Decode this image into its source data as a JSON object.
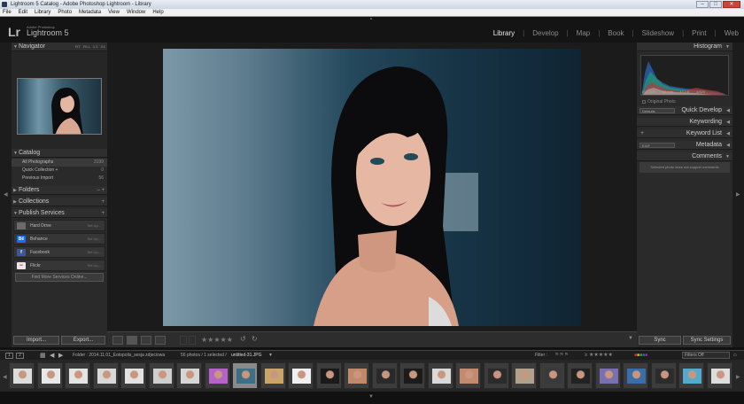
{
  "window": {
    "title": "Lightroom 5 Catalog - Adobe Photoshop Lightroom - Library",
    "controls": [
      "–",
      "□",
      "✕"
    ]
  },
  "menu": [
    "File",
    "Edit",
    "Library",
    "Photo",
    "Metadata",
    "View",
    "Window",
    "Help"
  ],
  "identity": {
    "logo": "Lr",
    "sub": "Adobe Photoshop",
    "name": "Lightroom 5"
  },
  "modules": [
    {
      "label": "Library",
      "active": true
    },
    {
      "label": "Develop",
      "active": false
    },
    {
      "label": "Map",
      "active": false
    },
    {
      "label": "Book",
      "active": false
    },
    {
      "label": "Slideshow",
      "active": false
    },
    {
      "label": "Print",
      "active": false
    },
    {
      "label": "Web",
      "active": false
    }
  ],
  "left": {
    "navigator": {
      "title": "Navigator",
      "zoom": [
        "FIT",
        "FILL",
        "1:1",
        "3:1"
      ]
    },
    "catalog": {
      "title": "Catalog",
      "rows": [
        {
          "label": "All Photographs",
          "count": "3199"
        },
        {
          "label": "Quick Collection +",
          "count": "0"
        },
        {
          "label": "Previous Import",
          "count": "56"
        }
      ]
    },
    "folders": {
      "title": "Folders",
      "action": "– +"
    },
    "collections": {
      "title": "Collections",
      "action": "+"
    },
    "publish": {
      "title": "Publish Services",
      "action": "+",
      "services": [
        {
          "label": "Hard Drive",
          "status": "Set Up...",
          "icon": "hard-drive-icon",
          "color": "#6b6b6b"
        },
        {
          "label": "Behance",
          "status": "Set Up...",
          "icon": "behance-icon",
          "color": "#1769ff",
          "glyph": "Bē"
        },
        {
          "label": "Facebook",
          "status": "Set Up...",
          "icon": "facebook-icon",
          "color": "#3b5998",
          "glyph": "f"
        },
        {
          "label": "Flickr",
          "status": "Set Up...",
          "icon": "flickr-icon",
          "color": "#e8e8e8",
          "glyph": "••"
        }
      ],
      "find_more": "Find More Services Online..."
    },
    "import_label": "Import...",
    "export_label": "Export..."
  },
  "right": {
    "histogram": {
      "title": "Histogram",
      "info": [
        "ISO 100",
        "82 mm",
        "f / 2.8",
        "1/320"
      ],
      "original_photo": "Original Photo"
    },
    "quick_develop": {
      "title": "Quick Develop",
      "select": "Defaults"
    },
    "keywording": {
      "title": "Keywording"
    },
    "keyword_list": {
      "title": "Keyword List",
      "action": "+"
    },
    "metadata": {
      "title": "Metadata",
      "select": "EXIF"
    },
    "comments": {
      "title": "Comments",
      "note": "Selected photo does not support comments"
    },
    "sync_label": "Sync",
    "sync_settings_label": "Sync Settings"
  },
  "filmstrip_bar": {
    "page1": "1",
    "page2": "2",
    "folder": "Folder : 2014.11.01_Eotopolis_sesja zdjeciowa",
    "count": "56 photos / 1 selected /",
    "filename": "untitled-31.JPG",
    "filter_label": "Filter :",
    "filters_off": "Filters Off"
  },
  "toolbar": {
    "stars": "★★★★★"
  },
  "colors": {
    "accent": "#dcdcdc",
    "panel": "#2a2a2a",
    "background": "#111111"
  }
}
